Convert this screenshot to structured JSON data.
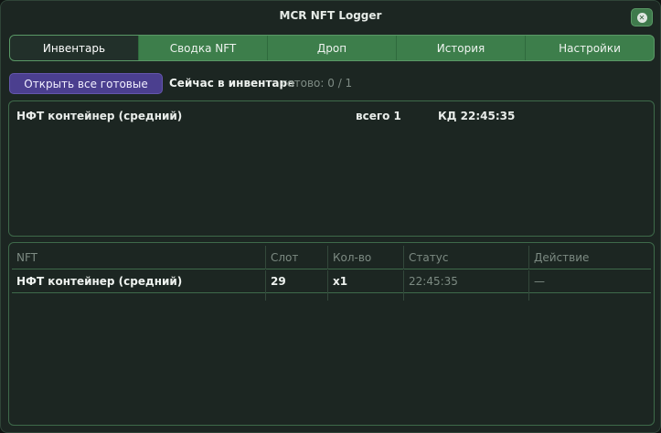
{
  "window": {
    "title": "MCR NFT Logger"
  },
  "tabs": [
    {
      "label": "Инвентарь",
      "active": true
    },
    {
      "label": "Сводка NFT",
      "active": false
    },
    {
      "label": "Дроп",
      "active": false
    },
    {
      "label": "История",
      "active": false
    },
    {
      "label": "Настройки",
      "active": false
    }
  ],
  "toolbar": {
    "open_all_label": "Открыть все готовые",
    "inventory_label": "Сейчас в инвентаре",
    "ready_label": "готово: 0 / 1"
  },
  "inventory_list": [
    {
      "name": "НФТ контейнер (средний)",
      "total": "всего 1",
      "cooldown": "КД 22:45:35"
    }
  ],
  "table": {
    "headers": [
      "NFT",
      "Слот",
      "Кол-во",
      "Статус",
      "Действие"
    ],
    "rows": [
      [
        "НФТ контейнер (средний)",
        "29",
        "x1",
        "22:45:35",
        "—"
      ]
    ]
  },
  "colors": {
    "background": "#1c2622",
    "tab_bar": "#3d7e4b",
    "primary_button": "#4b3f8f",
    "panel_border": "#3e6a4a"
  }
}
